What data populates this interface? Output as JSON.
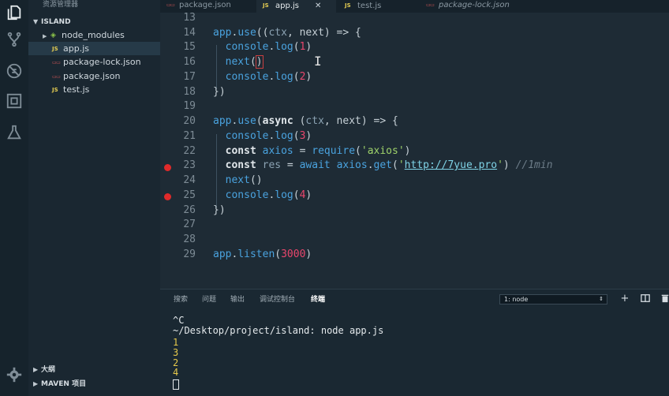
{
  "sidebar": {
    "title": "资源管理器",
    "section": "ISLAND",
    "items": [
      {
        "label": "node_modules",
        "icon": "node-folder-icon",
        "kind": "folder"
      },
      {
        "label": "app.js",
        "icon": "js-file-icon",
        "kind": "js"
      },
      {
        "label": "package-lock.json",
        "icon": "json-file-icon",
        "kind": "json"
      },
      {
        "label": "package.json",
        "icon": "json-file-icon",
        "kind": "json"
      },
      {
        "label": "test.js",
        "icon": "js-file-icon",
        "kind": "js"
      }
    ],
    "bottom_sections": [
      "大纲",
      "MAVEN 项目"
    ]
  },
  "tabs": [
    {
      "label": "package.json",
      "icon": "json-file-icon"
    },
    {
      "label": "app.js",
      "icon": "js-file-icon",
      "active": true
    },
    {
      "label": "test.js",
      "icon": "js-file-icon"
    },
    {
      "label": "package-lock.json",
      "icon": "json-file-icon",
      "italic": true
    }
  ],
  "editor": {
    "line_numbers": [
      "13",
      "14",
      "15",
      "16",
      "17",
      "18",
      "19",
      "20",
      "21",
      "22",
      "23",
      "24",
      "25",
      "26",
      "27",
      "28",
      "29"
    ],
    "breakpoint_lines": [
      "23",
      "25"
    ],
    "code": [
      "",
      "app.use((ctx, next) => {",
      "  console.log(1)",
      "  next()",
      "  console.log(2)",
      "})",
      "",
      "app.use(async (ctx, next) => {",
      "  console.log(3)",
      "  const axios = require('axios')",
      "  const res = await axios.get('http://7yue.pro') //1min",
      "  next()",
      "  console.log(4)",
      "})",
      "",
      "",
      "app.listen(3000)"
    ]
  },
  "panel": {
    "tabs": [
      "搜索",
      "问题",
      "输出",
      "调试控制台",
      "终端"
    ],
    "active_tab": "终端",
    "terminal_select": "1: node",
    "terminal_lines": [
      "^C",
      "~/Desktop/project/island: node app.js",
      "1",
      "3",
      "2",
      "4"
    ]
  },
  "colors": {
    "keyword": "#e0e6ea",
    "function": "#4aa3df",
    "number": "#e8466c",
    "string": "#9ed26a",
    "breakpoint": "#e02a2a"
  }
}
